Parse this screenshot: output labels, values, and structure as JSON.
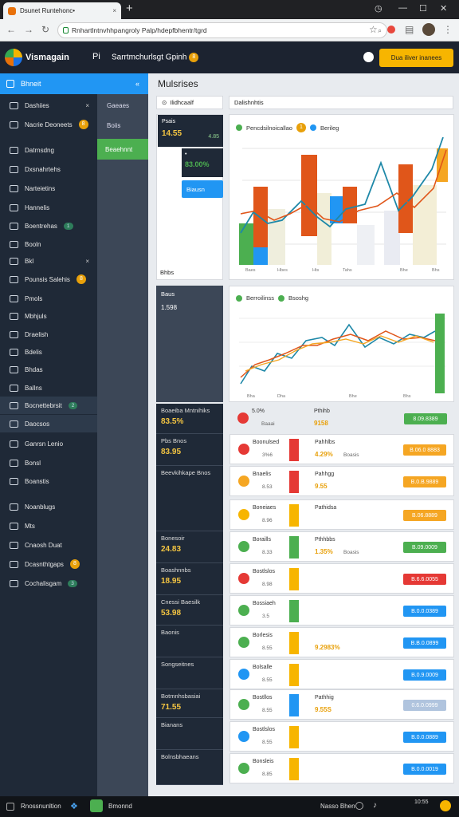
{
  "browser": {
    "tab_title": "Dsunet Runtehonc•",
    "close_glyph": "×",
    "new_tab_glyph": "+",
    "url": "Rnhartlntnvhhpangroly Palp/hdepfbhentr/tgrd"
  },
  "app": {
    "title": "Vismagain",
    "header_left_glyph": "Pi",
    "header_subtitle": "Sarrtmchurlsgt Gpinh",
    "header_badge": "8",
    "header_button": "Dua iliver inanees"
  },
  "sidebar": {
    "header": "Bhneit",
    "header_close": "«",
    "items": [
      {
        "label": "Dashiies",
        "close": "×"
      },
      {
        "label": "Nacrie Deoneets",
        "badge": "8"
      },
      {
        "label": "Datrnsdng"
      },
      {
        "label": "Dxsnahrtehs"
      },
      {
        "label": "Narteietins"
      },
      {
        "label": "Hannelis"
      },
      {
        "label": "Boentrehas",
        "pill": "1"
      },
      {
        "label": "Booln"
      },
      {
        "label": "Bkl",
        "close": "×"
      },
      {
        "label": "Pounsis Salehis",
        "badge": "8"
      },
      {
        "label": "Pmols"
      },
      {
        "label": "Mbhjuls"
      },
      {
        "label": "Draelish"
      },
      {
        "label": "Bdelis"
      },
      {
        "label": "Bhdas"
      },
      {
        "label": "Ballns"
      },
      {
        "label": "Bocnettebrsit",
        "pill": "2"
      },
      {
        "label": "Daocsos"
      },
      {
        "label": "Ganrsn Lenio"
      },
      {
        "label": "Bonsl"
      },
      {
        "label": "Boanstis"
      },
      {
        "label": "Noanblugs"
      },
      {
        "label": "Mts"
      },
      {
        "label": "Cnaosh Duat"
      },
      {
        "label": "Dcasnthtgaps",
        "badge": "8"
      },
      {
        "label": "Cochalisgam",
        "pill": "3"
      }
    ]
  },
  "subpanel": {
    "items": [
      "Gaeaes",
      "Boiis",
      "Beaehnnt"
    ]
  },
  "main": {
    "title": "Mulsrises",
    "filter1": "Ilidhcaalf",
    "filter2": "Dalishnhtis",
    "mini1": {
      "label": "Psais",
      "value": "14.55",
      "delta": "4.85"
    },
    "mini2": {
      "label": "•",
      "value": "83.00%",
      "delta": "•"
    },
    "mini3": "Biausn",
    "blank_card_footer": "Bhbs",
    "dark_tile": {
      "label": "Baus",
      "value": "1.598"
    },
    "chart1": {
      "legend": [
        "Pencdsilnoicallao",
        "Berileg"
      ],
      "badge": "1",
      "ticks": [
        "Baes",
        "Hbes",
        "Hts",
        "Tahs",
        "Bhe",
        "Bhs"
      ]
    },
    "chart2": {
      "legend": [
        "Berroilinss",
        "Bsoshg"
      ],
      "ticks": [
        "Bha",
        "Dha",
        "Bhe",
        "Bhs"
      ]
    },
    "left_tiles": [
      {
        "label": "Boaeiba Mntnihiks",
        "value": "83.5%"
      },
      {
        "label": "Pbs Bnos",
        "value": "83.95"
      },
      {
        "label": "Beevkihkape Bnos",
        "value": ""
      },
      {
        "label": "Bonesoir",
        "value": "24.83"
      },
      {
        "label": "Boashnnbs",
        "value": "18.95"
      },
      {
        "label": "Cnessi Baesilk",
        "value": "53.98"
      },
      {
        "label": "Baonis",
        "value": ""
      },
      {
        "label": "Songseitnes",
        "value": ""
      },
      {
        "label": "Botmnhsbasiai",
        "value": "71.55"
      },
      {
        "label": "Bianans",
        "value": ""
      },
      {
        "label": "Bolnsbhaeans",
        "value": ""
      }
    ],
    "rows": [
      {
        "name": "5.0%",
        "sub": "Baaai",
        "metric_title": "Pthihb",
        "metric": "9158",
        "button": "8.09.8389"
      },
      {
        "name": "Boonulsed",
        "sub": "3%6",
        "metric_title": "Pahhlbs",
        "metric": "4.29%",
        "detail": "Boasis",
        "button": "B.06.0 8883"
      },
      {
        "name": "Bnaelis",
        "sub": "8.53",
        "metric_title": "Pahhgg",
        "metric": "9.55",
        "button": "B.0.B.9889"
      },
      {
        "name": "Boneiaes",
        "sub": "8.96",
        "metric_title": "Pathidsa",
        "metric": "",
        "button": "B.06.8889"
      },
      {
        "name": "Boraills",
        "sub": "8.33",
        "metric_title": "Pthhbbs",
        "metric": "1.35%",
        "detail": "Boasis",
        "button": "B.09.0009"
      },
      {
        "name": "Bostlslos",
        "sub": "8.98",
        "metric_title": "",
        "metric": "",
        "button": "B.6.6.0055"
      },
      {
        "name": "Bossiaeh",
        "sub": "3.5",
        "metric_title": "",
        "metric": "",
        "button": "B.0.0.0389"
      },
      {
        "name": "Borlesis",
        "sub": "8.55",
        "metric_title": "",
        "metric": "9.2983%",
        "button": "B.B.0.0899"
      },
      {
        "name": "Bolsalle",
        "sub": "8.55",
        "metric_title": "",
        "metric": "",
        "button": "B.0.9.0009"
      },
      {
        "name": "Bostllos",
        "sub": "8.55",
        "metric_title": "Pathhig",
        "metric": "9.55S",
        "button": "0.6.0.0999"
      },
      {
        "name": "Bostlslos",
        "sub": "8.55",
        "metric_title": "",
        "metric": "",
        "button": "B.0.0.0889"
      },
      {
        "name": "Bonsleis",
        "sub": "8.85",
        "metric_title": "",
        "metric": "",
        "button": "B.0.0.0019"
      }
    ]
  },
  "taskbar": {
    "left": "Rnossnunltion",
    "app": "Bmonnd",
    "right": "Nasso Bhen",
    "time": "10:55"
  },
  "colors": {
    "accent_blue": "#2196f3",
    "green": "#4caf50",
    "orange": "#f5a623",
    "red": "#e53935",
    "yellow": "#f7b500",
    "teal_line": "#1e88a8",
    "chart_orange": "#e0561a"
  }
}
